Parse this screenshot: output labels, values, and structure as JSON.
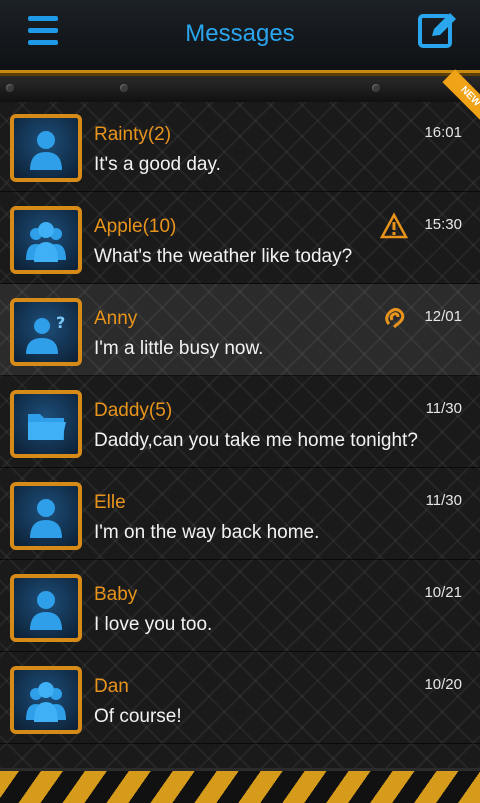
{
  "header": {
    "title": "Messages",
    "menu_icon": "menu-icon",
    "compose_icon": "compose-icon",
    "new_badge": "NEW"
  },
  "colors": {
    "accent_blue": "#2aa6ef",
    "accent_orange": "#e8941c",
    "text": "#f2f2f2"
  },
  "conversations": [
    {
      "name": "Rainty(2)",
      "message": "It's a good day.",
      "time": "16:01",
      "avatar": "person-icon"
    },
    {
      "name": "Apple(10)",
      "message": "What's the weather like today?",
      "time": "15:30",
      "avatar": "group-icon",
      "status_icon": "warning-icon"
    },
    {
      "name": "Anny",
      "message": "I'm a little busy now.",
      "time": "12/01",
      "avatar": "unknown-person-icon",
      "status_icon": "attachment-icon"
    },
    {
      "name": "Daddy(5)",
      "message": "Daddy,can you take me home tonight?",
      "time": "11/30",
      "avatar": "folder-icon"
    },
    {
      "name": "Elle",
      "message": "I'm on the way back home.",
      "time": "11/30",
      "avatar": "person-icon"
    },
    {
      "name": "Baby",
      "message": "I love you too.",
      "time": "10/21",
      "avatar": "person-icon"
    },
    {
      "name": "Dan",
      "message": "Of course!",
      "time": "10/20",
      "avatar": "group-icon"
    }
  ]
}
